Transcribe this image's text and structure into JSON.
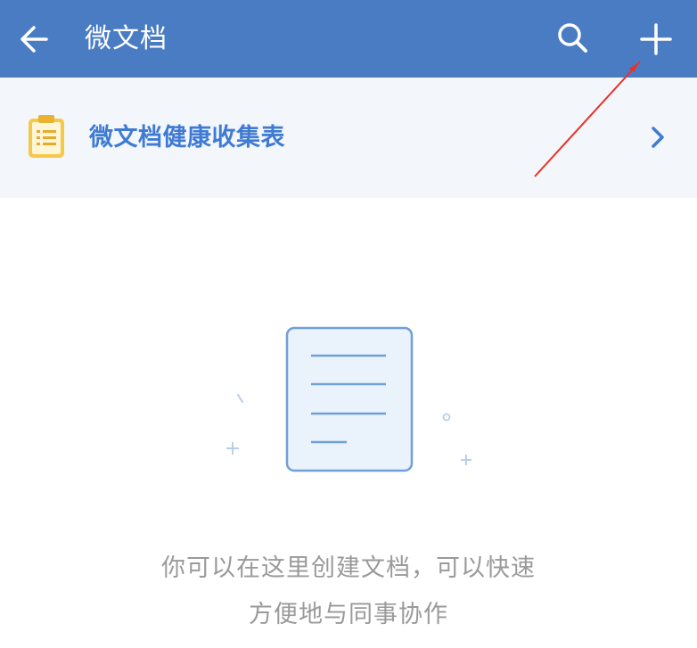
{
  "header": {
    "title": "微文档",
    "back_icon": "arrow-left-icon",
    "search_icon": "search-icon",
    "add_icon": "plus-icon",
    "background_color": "#4a7cc4"
  },
  "pinned": {
    "label": "微文档健康收集表",
    "icon": "clipboard-icon",
    "chevron_icon": "chevron-right-icon",
    "label_color": "#3f7bd3"
  },
  "empty_state": {
    "icon": "document-icon",
    "line1": "你可以在这里创建文档，可以快速",
    "line2": "方便地与同事协作"
  }
}
